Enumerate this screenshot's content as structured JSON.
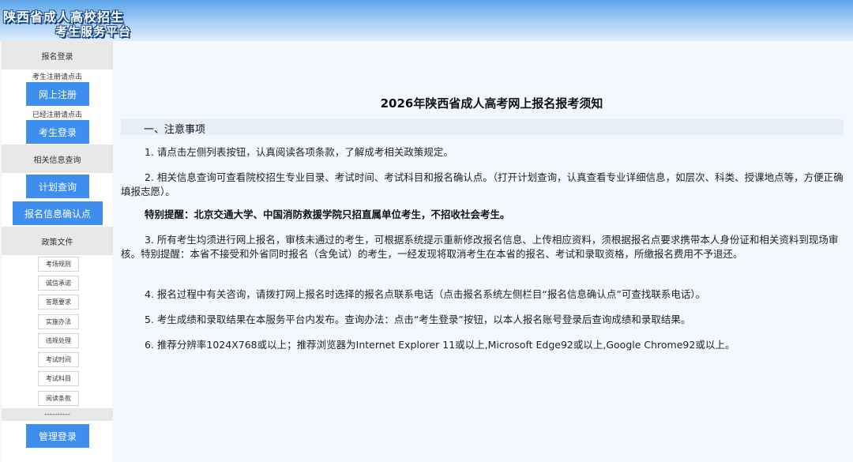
{
  "header": {
    "logo_line1": "陕西省成人高校招生",
    "logo_line2": "考生服务平台"
  },
  "sidebar": {
    "registration_header": "报名登录",
    "register_hint": "考生注册请点击",
    "register_button": "网上注册",
    "login_hint": "已经注册请点击",
    "login_button": "考生登录",
    "info_header": "相关信息查询",
    "plan_button": "计划查询",
    "confirm_button": "报名信息确认点",
    "policy_header": "政策文件",
    "policy_links": [
      "考场规则",
      "诚信承诺",
      "答题要求",
      "实施办法",
      "违规处理",
      "考试时间",
      "考试科目",
      "阅读条款"
    ],
    "divider_text": "----------",
    "admin_button": "管理登录"
  },
  "main": {
    "title": "2026年陕西省成人高考网上报名报考须知",
    "section_title": "一、注意事项",
    "items": [
      "1.  请点击左侧列表按钮，认真阅读各项条款，了解成考相关政策规定。",
      "2. 相关信息查询可查看院校招生专业目录、考试时间、考试科目和报名确认点。（打开计划查询，认真查看专业详细信息，如层次、科类、授课地点等，方便正确填报志愿）。",
      "特别提醒：北京交通大学、中国消防救援学院只招直属单位考生，不招收社会考生。",
      "3. 所有考生均须进行网上报名，审核未通过的考生，可根据系统提示重新修改报名信息、上传相应资料，须根据报名点要求携带本人身份证和相关资料到现场审核。特别提醒：本省不接受和外省同时报名（含免试）的考生，一经发现将取消考生在本省的报名、考试和录取资格，所缴报名费用不予退还。",
      "4. 报名过程中有关咨询，请拨打网上报名时选择的报名点联系电话（点击报名系统左侧栏目“报名信息确认点”可查找联系电话）。",
      "5. 考生成绩和录取结果在本服务平台内发布。查询办法：点击“考生登录”按钮，以本人报名账号登录后查询成绩和录取结果。",
      "6. 推荐分辨率1024X768或以上；推荐浏览器为Internet Explorer 11或以上,Microsoft Edge92或以上,Google Chrome92或以上。"
    ]
  }
}
